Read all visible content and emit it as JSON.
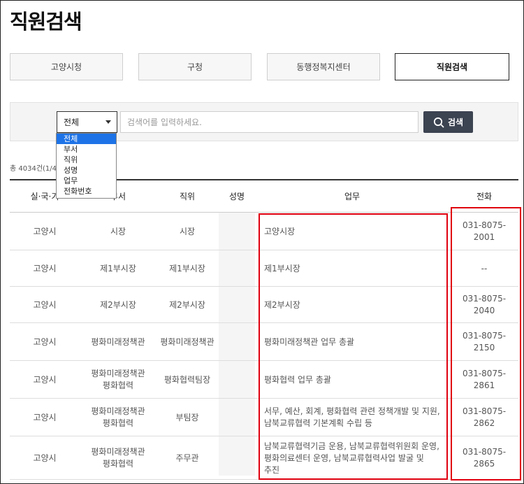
{
  "page": {
    "title": "직원검색"
  },
  "tabs": [
    {
      "label": "고양시청",
      "active": false
    },
    {
      "label": "구청",
      "active": false
    },
    {
      "label": "동행정복지센터",
      "active": false
    },
    {
      "label": "직원검색",
      "active": true
    }
  ],
  "search": {
    "selected": "전체",
    "placeholder": "검색어를 입력하세요.",
    "button_label": "검색",
    "options": [
      "전체",
      "부서",
      "직위",
      "성명",
      "업무",
      "전화번호"
    ]
  },
  "total_text": "총 4034건(1/4",
  "table": {
    "headers": [
      "실·국·기",
      "부서",
      "직위",
      "성명",
      "업무",
      "전화"
    ],
    "rows": [
      {
        "org": "고양시",
        "dept": [
          "시장"
        ],
        "position": "시장",
        "name": "",
        "duty": [
          "고양시장"
        ],
        "phone": [
          "031-8075-",
          "2001"
        ]
      },
      {
        "org": "고양시",
        "dept": [
          "제1부시장"
        ],
        "position": "제1부시장",
        "name": "",
        "duty": [
          "제1부시장"
        ],
        "phone": [
          "--"
        ]
      },
      {
        "org": "고양시",
        "dept": [
          "제2부시장"
        ],
        "position": "제2부시장",
        "name": "",
        "duty": [
          "제2부시장"
        ],
        "phone": [
          "031-8075-",
          "2040"
        ]
      },
      {
        "org": "고양시",
        "dept": [
          "평화미래정책관"
        ],
        "position": "평화미래정책관",
        "name": "",
        "duty": [
          "평화미래정책관 업무 총괄"
        ],
        "phone": [
          "031-8075-",
          "2150"
        ]
      },
      {
        "org": "고양시",
        "dept": [
          "평화미래정책관",
          "평화협력"
        ],
        "position": "평화협력팀장",
        "name": "",
        "duty": [
          "평화협력 업무 총괄"
        ],
        "phone": [
          "031-8075-",
          "2861"
        ]
      },
      {
        "org": "고양시",
        "dept": [
          "평화미래정책관",
          "평화협력"
        ],
        "position": "부팀장",
        "name": "",
        "duty": [
          "서무, 예산, 회계, 평화협력 관련 정책개발 및 지원,",
          "남북교류협력 기본계획 수립 등"
        ],
        "phone": [
          "031-8075-",
          "2862"
        ]
      },
      {
        "org": "고양시",
        "dept": [
          "평화미래정책관",
          "평화협력"
        ],
        "position": "주무관",
        "name": "",
        "duty": [
          "남북교류협력기금 운용, 남북교류협력위원회 운영,",
          "평화의료센터 운영, 남북교류협력사업 발굴 및",
          "추진"
        ],
        "phone": [
          "031-8075-",
          "2865"
        ]
      }
    ]
  },
  "colors": {
    "active_border": "#222222",
    "search_button": "#3c4351",
    "dropdown_highlight": "#1e73e6",
    "annotation_red": "#e0000f"
  },
  "icons": {
    "search_button_icon": "search-icon",
    "select_arrow": "caret-down-icon"
  }
}
